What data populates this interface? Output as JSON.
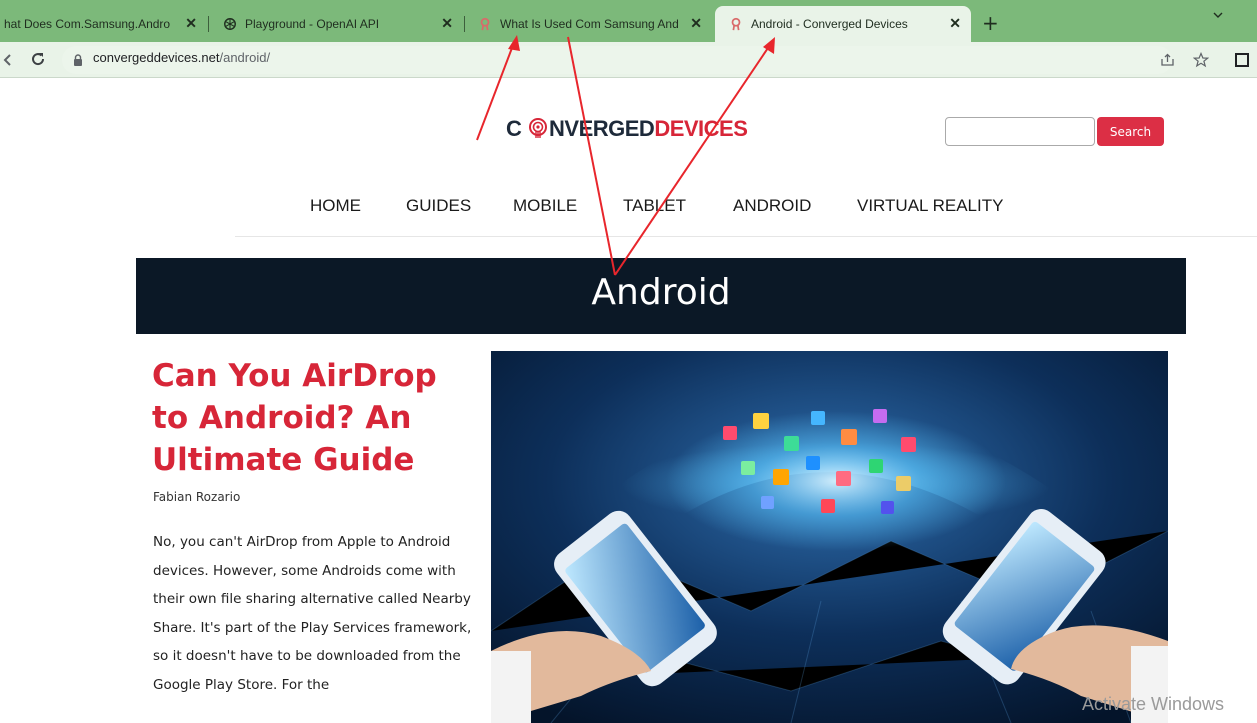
{
  "browser": {
    "tabs": [
      {
        "title": "hat Does Com.Samsung.Andro",
        "active": false
      },
      {
        "title": "Playground - OpenAI API",
        "active": false
      },
      {
        "title": "What Is Used Com Samsung And",
        "active": false
      },
      {
        "title": "Android - Converged Devices",
        "active": true
      }
    ],
    "new_tab": "+",
    "tab_close": "✕",
    "url_host": "convergeddevices.net",
    "url_path": "/android/"
  },
  "site": {
    "logo_left": "C",
    "logo_mid": "NVERGED",
    "logo_right": "DEVICES",
    "search_button": "Search",
    "search_value": "",
    "nav": [
      "HOME",
      "GUIDES",
      "MOBILE",
      "TABLET",
      "ANDROID",
      "VIRTUAL REALITY"
    ]
  },
  "banner": {
    "title": "Android"
  },
  "article": {
    "title": "Can You AirDrop to Android? An Ultimate Guide",
    "author": "Fabian Rozario",
    "excerpt": "No, you can't AirDrop from Apple to Android devices. However, some Androids come with their own file sharing alternative called Nearby Share. It's part of the Play Services framework, so it doesn't have to be downloaded from the Google Play Store. For the"
  },
  "watermark": "Activate Windows",
  "colors": {
    "tabbar": "#7cb97a",
    "accent_red": "#d72638",
    "banner": "#0b1826",
    "annotation_red": "#e8262c"
  },
  "icons": {
    "back": "back-arrow-icon",
    "reload": "reload-icon",
    "lock": "lock-icon",
    "share": "share-icon",
    "bookmark": "star-icon",
    "sidepanel": "side-panel-icon"
  }
}
